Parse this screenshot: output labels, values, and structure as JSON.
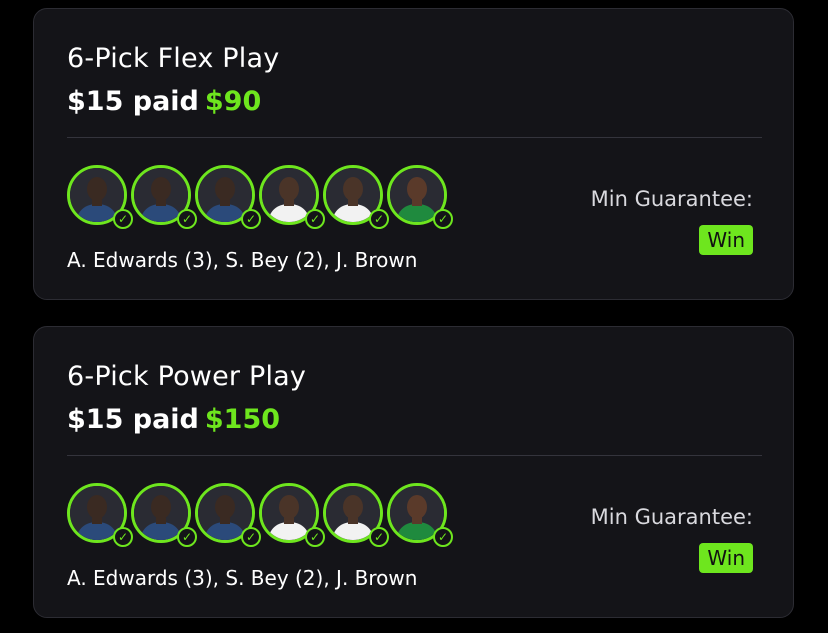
{
  "colors": {
    "background": "#000000",
    "card_bg": "#141418",
    "card_border": "#2c2c33",
    "accent_green": "#6ee61e",
    "jersey_wolves": "#2b4a7a",
    "jersey_celtics": "#1f8a3e",
    "jersey_white": "#f2f2f2"
  },
  "cards": [
    {
      "title": "6-Pick Flex Play",
      "paid_label": "$15 paid",
      "payout": "$90",
      "players_text": "A. Edwards (3), S. Bey (2), J. Brown",
      "min_guarantee_label": "Min Guarantee:",
      "result_badge": "Win",
      "picks": [
        {
          "player": "A. Edwards",
          "jersey": "wolves",
          "status": "check-icon"
        },
        {
          "player": "A. Edwards",
          "jersey": "wolves",
          "status": "check-icon"
        },
        {
          "player": "A. Edwards",
          "jersey": "wolves",
          "status": "check-icon"
        },
        {
          "player": "S. Bey",
          "jersey": "white",
          "status": "check-icon"
        },
        {
          "player": "S. Bey",
          "jersey": "white",
          "status": "check-icon"
        },
        {
          "player": "J. Brown",
          "jersey": "celtics",
          "status": "check-icon"
        }
      ]
    },
    {
      "title": "6-Pick Power Play",
      "paid_label": "$15 paid",
      "payout": "$150",
      "players_text": "A. Edwards (3), S. Bey (2), J. Brown",
      "min_guarantee_label": "Min Guarantee:",
      "result_badge": "Win",
      "picks": [
        {
          "player": "A. Edwards",
          "jersey": "wolves",
          "status": "check-icon"
        },
        {
          "player": "A. Edwards",
          "jersey": "wolves",
          "status": "check-icon"
        },
        {
          "player": "A. Edwards",
          "jersey": "wolves",
          "status": "check-icon"
        },
        {
          "player": "S. Bey",
          "jersey": "white",
          "status": "check-icon"
        },
        {
          "player": "S. Bey",
          "jersey": "white",
          "status": "check-icon"
        },
        {
          "player": "J. Brown",
          "jersey": "celtics",
          "status": "check-icon"
        }
      ]
    }
  ]
}
